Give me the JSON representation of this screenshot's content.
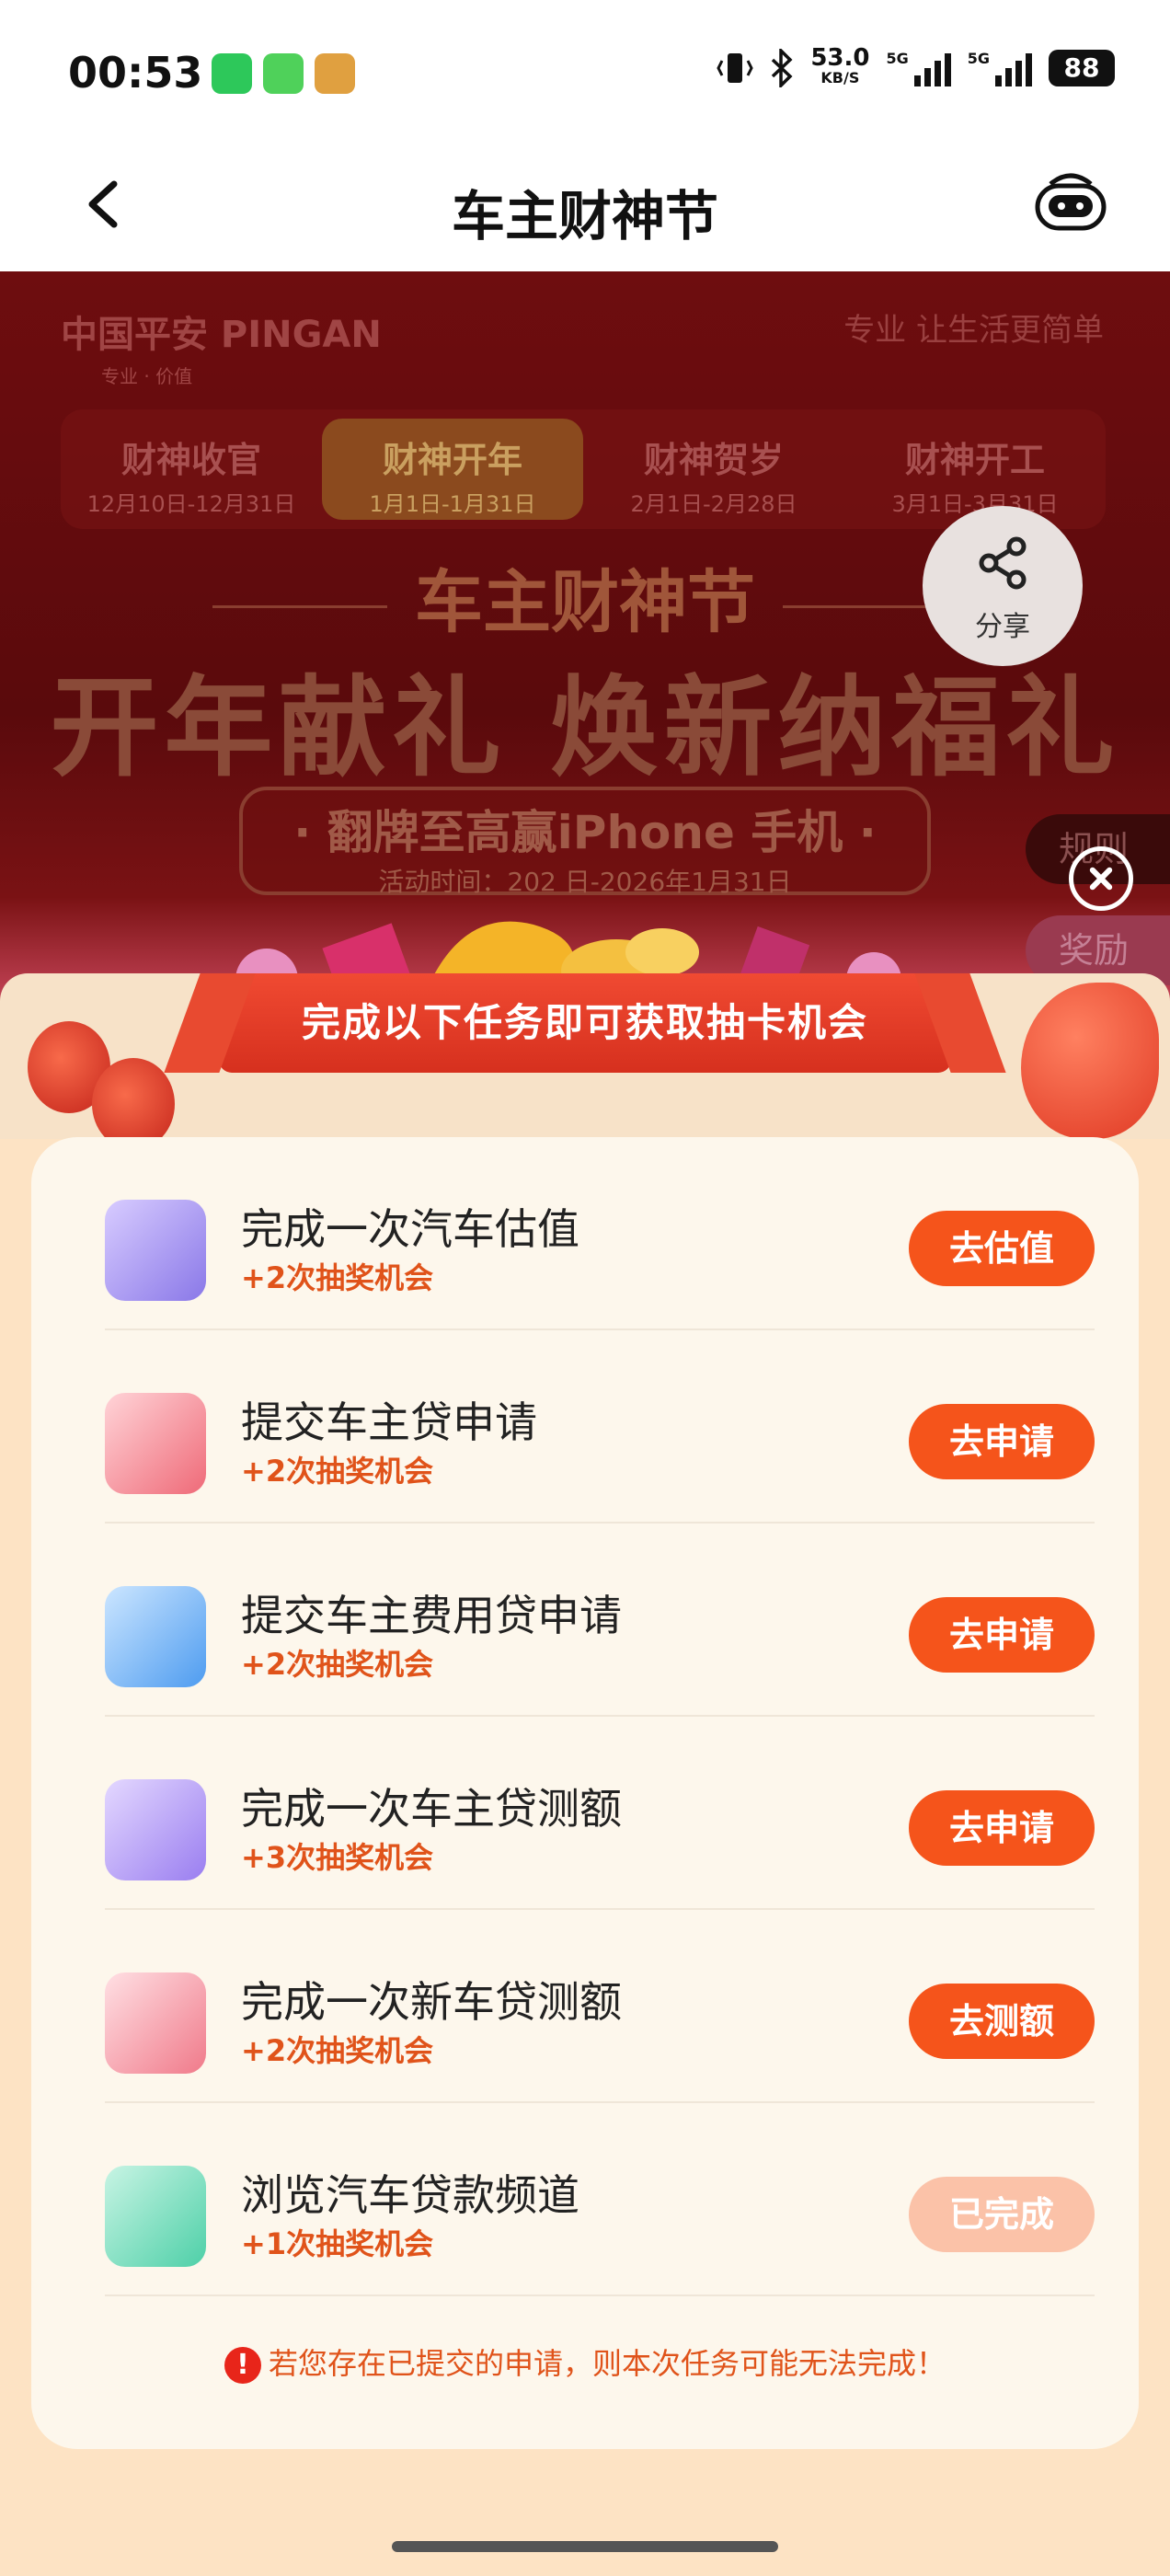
{
  "status_bar": {
    "time": "00:53",
    "net_speed": "53.0",
    "net_unit": "KB/S",
    "signal1_label": "5G",
    "signal2_label": "5G",
    "battery": "88"
  },
  "nav": {
    "title": "车主财神节",
    "back_icon": "chevron-left-icon",
    "assistant_icon": "robot-icon"
  },
  "banner": {
    "brand": "中国平安 PINGAN",
    "brand_tag": "专业 · 价值",
    "slogan": "专业 让生活更简单",
    "tabs": [
      {
        "name": "财神收官",
        "date": "12月10日-12月31日"
      },
      {
        "name": "财神开年",
        "date": "1月1日-1月31日",
        "active": true
      },
      {
        "name": "财神贺岁",
        "date": "2月1日-2月28日"
      },
      {
        "name": "财神开工",
        "date": "3月1日-3月31日"
      }
    ],
    "festival": "车主财神节",
    "headline": "开年献礼 焕新纳福礼",
    "flip_title": "· 翻牌至高赢iPhone 手机 ·",
    "activity_time": "活动时间：202      日-2026年1月31日",
    "share_label": "分享",
    "rules_label": "规则",
    "rewards_label": "奖励"
  },
  "panel": {
    "ribbon": "完成以下任务即可获取抽卡机会",
    "tasks": [
      {
        "title": "完成一次汽车估值",
        "sub": "+2次抽奖机会",
        "button": "去估值",
        "icon": "car-icon",
        "color": "#8a78e8"
      },
      {
        "title": "提交车主贷申请",
        "sub": "+2次抽奖机会",
        "button": "去申请",
        "icon": "wallet-icon",
        "color": "#ef6a78"
      },
      {
        "title": "提交车主费用贷申请",
        "sub": "+2次抽奖机会",
        "button": "去申请",
        "icon": "document-icon",
        "color": "#4e9cf0"
      },
      {
        "title": "完成一次车主贷测额",
        "sub": "+3次抽奖机会",
        "button": "去申请",
        "icon": "calculator-icon",
        "color": "#9a7ef0"
      },
      {
        "title": "完成一次新车贷测额",
        "sub": "+2次抽奖机会",
        "button": "去测额",
        "icon": "chart-icon",
        "color": "#f07a8a"
      },
      {
        "title": "浏览汽车贷款频道",
        "sub": "+1次抽奖机会",
        "button": "已完成",
        "icon": "coin-doc-icon",
        "color": "#4ed0a8",
        "done": true
      }
    ],
    "notice": "若您存在已提交的申请，则本次任务可能无法完成！"
  }
}
